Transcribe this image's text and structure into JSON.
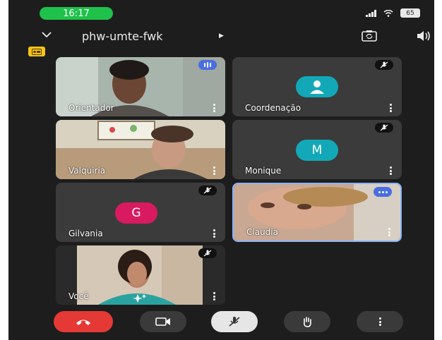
{
  "status_bar": {
    "time": "16:17",
    "battery": "65"
  },
  "header": {
    "meeting_code": "phw-umte-fwk"
  },
  "participants": [
    {
      "name": "Orientador"
    },
    {
      "name": "Coordenação"
    },
    {
      "name": "Valquiria"
    },
    {
      "name": "Monique",
      "initial": "M",
      "avatar_color": "#13a8b8"
    },
    {
      "name": "Gilvania",
      "initial": "G",
      "avatar_color": "#d81b60"
    },
    {
      "name": "Claudia"
    },
    {
      "name": "Você"
    }
  ],
  "colors": {
    "status_time_bg": "#1ec24a",
    "end_call": "#e53935",
    "active_speaker_border": "#8ab4f8",
    "record_badge": "#f5c518"
  },
  "icons": [
    "chevron-down-icon",
    "camera-switch-icon",
    "speaker-icon",
    "recording-icon",
    "mic-off-icon",
    "more-vert-icon",
    "audio-level-icon",
    "person-icon",
    "effects-icon",
    "end-call-icon",
    "video-camera-icon",
    "raise-hand-icon"
  ]
}
